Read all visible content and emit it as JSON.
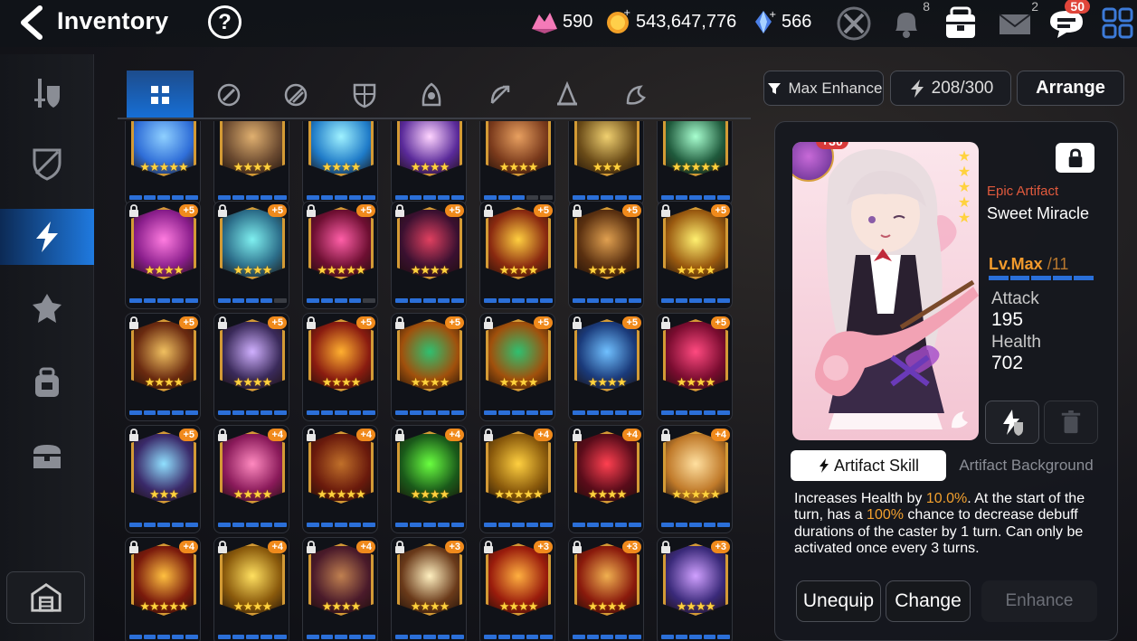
{
  "header": {
    "title": "Inventory",
    "help_glyph": "?",
    "currencies": [
      {
        "icon": "crystal-icon",
        "value": "590"
      },
      {
        "icon": "gold-icon",
        "value": "543,647,776"
      },
      {
        "icon": "skystone-icon",
        "value": "566"
      }
    ],
    "badges": {
      "notifications": "8",
      "mail": "2",
      "chat": "50"
    }
  },
  "sidebar": {
    "items": [
      "equipment",
      "artifact-off",
      "artifact",
      "catalyst",
      "bag",
      "chest"
    ],
    "active_index": 2
  },
  "tabs": {
    "items": [
      "all",
      "knight",
      "warrior",
      "defender",
      "thief",
      "ranger",
      "mage",
      "soul-weaver"
    ],
    "active_index": 0
  },
  "artifacts": [
    {
      "row": 0,
      "plus": "",
      "locked": false,
      "stars": 5,
      "color": "#2f6ed8",
      "accent": "#8fd0ff",
      "bars": 5
    },
    {
      "row": 0,
      "plus": "",
      "locked": false,
      "stars": 4,
      "color": "#6b4a30",
      "accent": "#e0b070",
      "bars": 5
    },
    {
      "row": 0,
      "plus": "",
      "locked": false,
      "stars": 4,
      "color": "#1f7bc8",
      "accent": "#9ff2ff",
      "bars": 5
    },
    {
      "row": 0,
      "plus": "",
      "locked": false,
      "stars": 4,
      "color": "#5a2a9a",
      "accent": "#ffd4ff",
      "bars": 5
    },
    {
      "row": 0,
      "plus": "",
      "locked": false,
      "stars": 4,
      "color": "#7a3a1c",
      "accent": "#e8a060",
      "bars": 3
    },
    {
      "row": 0,
      "plus": "",
      "locked": false,
      "stars": 3,
      "color": "#6a4b18",
      "accent": "#f0d070",
      "bars": 5
    },
    {
      "row": 0,
      "plus": "",
      "locked": false,
      "stars": 5,
      "color": "#1f5a3c",
      "accent": "#a8ffd0",
      "bars": 5
    },
    {
      "row": 1,
      "plus": "+5",
      "locked": true,
      "stars": 4,
      "color": "#8a1e8c",
      "accent": "#ff7ce0",
      "bars": 5
    },
    {
      "row": 1,
      "plus": "+5",
      "locked": true,
      "stars": 4,
      "color": "#2c6e8a",
      "accent": "#7ff0f0",
      "bars": 4
    },
    {
      "row": 1,
      "plus": "+5",
      "locked": true,
      "stars": 5,
      "color": "#6e0f32",
      "accent": "#ff5fa8",
      "bars": 4
    },
    {
      "row": 1,
      "plus": "+5",
      "locked": true,
      "stars": 4,
      "color": "#3a1030",
      "accent": "#e04060",
      "bars": 5
    },
    {
      "row": 1,
      "plus": "+5",
      "locked": true,
      "stars": 4,
      "color": "#8a2a10",
      "accent": "#ffcf40",
      "bars": 5
    },
    {
      "row": 1,
      "plus": "+5",
      "locked": true,
      "stars": 4,
      "color": "#5a3010",
      "accent": "#e0a050",
      "bars": 5
    },
    {
      "row": 1,
      "plus": "+5",
      "locked": true,
      "stars": 4,
      "color": "#9a5a10",
      "accent": "#fff070",
      "bars": 5
    },
    {
      "row": 2,
      "plus": "+5",
      "locked": true,
      "stars": 4,
      "color": "#6a2a10",
      "accent": "#f0c060",
      "bars": 5
    },
    {
      "row": 2,
      "plus": "+5",
      "locked": true,
      "stars": 4,
      "color": "#3a2a5a",
      "accent": "#d0b0ff",
      "bars": 5
    },
    {
      "row": 2,
      "plus": "+5",
      "locked": true,
      "stars": 4,
      "color": "#8a1c10",
      "accent": "#ffb030",
      "bars": 5
    },
    {
      "row": 2,
      "plus": "+5",
      "locked": true,
      "stars": 4,
      "color": "#a0500c",
      "accent": "#2fc070",
      "bars": 5
    },
    {
      "row": 2,
      "plus": "+5",
      "locked": true,
      "stars": 4,
      "color": "#a0500c",
      "accent": "#2fc070",
      "bars": 5
    },
    {
      "row": 2,
      "plus": "+5",
      "locked": true,
      "stars": 4,
      "color": "#1a3a7a",
      "accent": "#70c0ff",
      "bars": 5
    },
    {
      "row": 2,
      "plus": "+5",
      "locked": true,
      "stars": 4,
      "color": "#7a0c30",
      "accent": "#ff4a80",
      "bars": 5
    },
    {
      "row": 3,
      "plus": "+5",
      "locked": true,
      "stars": 3,
      "color": "#3a2a6a",
      "accent": "#90e0ff",
      "bars": 5
    },
    {
      "row": 3,
      "plus": "+4",
      "locked": true,
      "stars": 4,
      "color": "#8a1a5a",
      "accent": "#ff8ac0",
      "bars": 5
    },
    {
      "row": 3,
      "plus": "+4",
      "locked": true,
      "stars": 5,
      "color": "#6a1a0c",
      "accent": "#c0702a",
      "bars": 5
    },
    {
      "row": 3,
      "plus": "+4",
      "locked": true,
      "stars": 4,
      "color": "#1a5a1a",
      "accent": "#6aff40",
      "bars": 5
    },
    {
      "row": 3,
      "plus": "+4",
      "locked": true,
      "stars": 5,
      "color": "#8a5a0c",
      "accent": "#ffd040",
      "bars": 5
    },
    {
      "row": 3,
      "plus": "+4",
      "locked": true,
      "stars": 4,
      "color": "#5a0c1a",
      "accent": "#ff4050",
      "bars": 5
    },
    {
      "row": 3,
      "plus": "+4",
      "locked": true,
      "stars": 5,
      "color": "#c07a2a",
      "accent": "#ffe0a0",
      "bars": 5
    },
    {
      "row": 4,
      "plus": "+4",
      "locked": true,
      "stars": 5,
      "color": "#7a1a0c",
      "accent": "#ffc040",
      "bars": 5
    },
    {
      "row": 4,
      "plus": "+4",
      "locked": true,
      "stars": 4,
      "color": "#8a5a0c",
      "accent": "#ffe060",
      "bars": 5
    },
    {
      "row": 4,
      "plus": "+4",
      "locked": true,
      "stars": 4,
      "color": "#4a1a2a",
      "accent": "#c08050",
      "bars": 5
    },
    {
      "row": 4,
      "plus": "+3",
      "locked": true,
      "stars": 4,
      "color": "#6a3a1a",
      "accent": "#fff0c0",
      "bars": 5
    },
    {
      "row": 4,
      "plus": "+3",
      "locked": true,
      "stars": 4,
      "color": "#9a1c0c",
      "accent": "#ffb040",
      "bars": 5
    },
    {
      "row": 4,
      "plus": "+3",
      "locked": true,
      "stars": 4,
      "color": "#8a1a0c",
      "accent": "#f0b050",
      "bars": 5
    },
    {
      "row": 4,
      "plus": "+3",
      "locked": true,
      "stars": 4,
      "color": "#3a2a7a",
      "accent": "#d0a0ff",
      "bars": 5
    }
  ],
  "toolbar": {
    "max_enhance_label": "Max Enhance",
    "capacity": "208/300",
    "arrange_label": "Arrange"
  },
  "detail": {
    "enhance_level": "+30",
    "rarity": "Epic Artifact",
    "name": "Sweet Miracle",
    "level_label": "Lv.Max",
    "level_max": "/11",
    "stars": 5,
    "attack_label": "Attack",
    "attack_value": "195",
    "health_label": "Health",
    "health_value": "702",
    "skill_tab_label": "Artifact Skill",
    "background_tab_label": "Artifact Background",
    "desc_parts": [
      "Increases Health by ",
      "10.0%",
      ". At the start of the turn, has a ",
      "100%",
      " chance to decrease debuff durations of the caster by 1 turn. Can only be activated once every 3 turns."
    ],
    "unequip_label": "Unequip",
    "change_label": "Change",
    "enhance_label": "Enhance"
  },
  "colors": {
    "accent_blue": "#1f7ae0",
    "orange": "#f29a2c",
    "rarity_red": "#e25a3d"
  }
}
